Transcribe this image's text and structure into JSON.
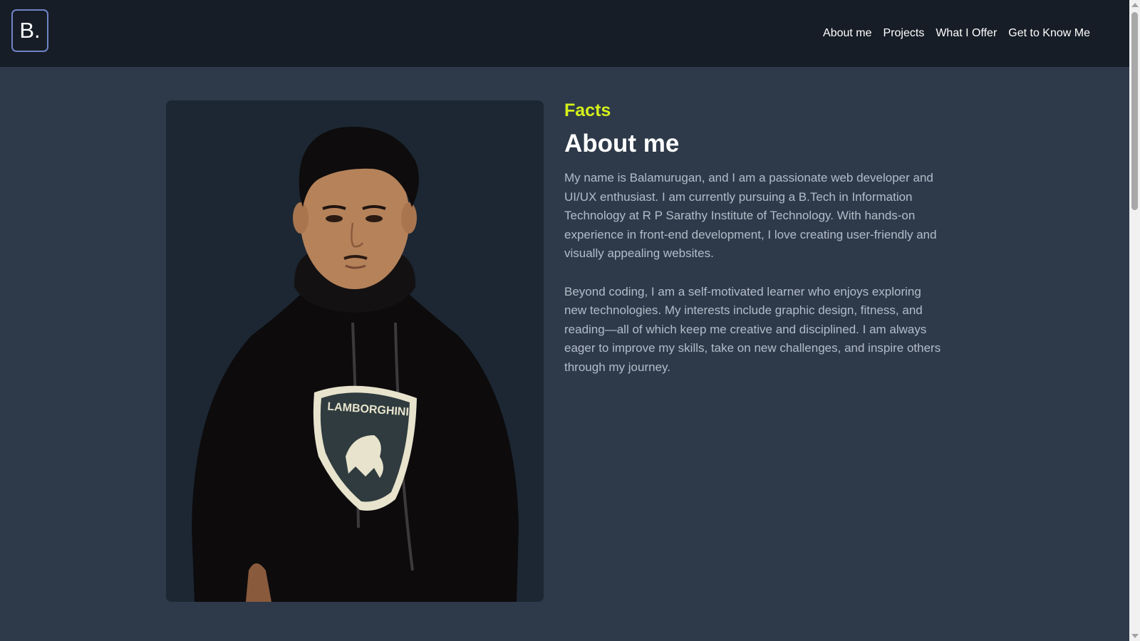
{
  "header": {
    "logo_text": "B.",
    "nav": [
      {
        "label": "About me"
      },
      {
        "label": "Projects"
      },
      {
        "label": "What I Offer"
      },
      {
        "label": "Get to Know Me"
      }
    ]
  },
  "about": {
    "eyebrow": "Facts",
    "title": "About me",
    "paragraphs": [
      "My name is Balamurugan, and I am a passionate web developer and UI/UX enthusiast. I am currently pursuing a B.Tech in Information Technology at R P Sarathy Institute of Technology. With hands-on experience in front-end development, I love creating user-friendly and visually appealing websites.",
      "Beyond coding, I am a self-motivated learner who enjoys exploring new technologies. My interests include graphic design, fitness, and reading—all of which keep me creative and disciplined. I am always eager to improve my skills, take on new challenges, and inspire others through my journey."
    ],
    "photo_logo_text": "LAMBORGHINI"
  },
  "colors": {
    "page_background": "#2e3a4a",
    "header_background": "#161d26",
    "accent": "#d4f01a",
    "logo_border": "#6f83c8",
    "body_text": "#b3bcc8"
  }
}
